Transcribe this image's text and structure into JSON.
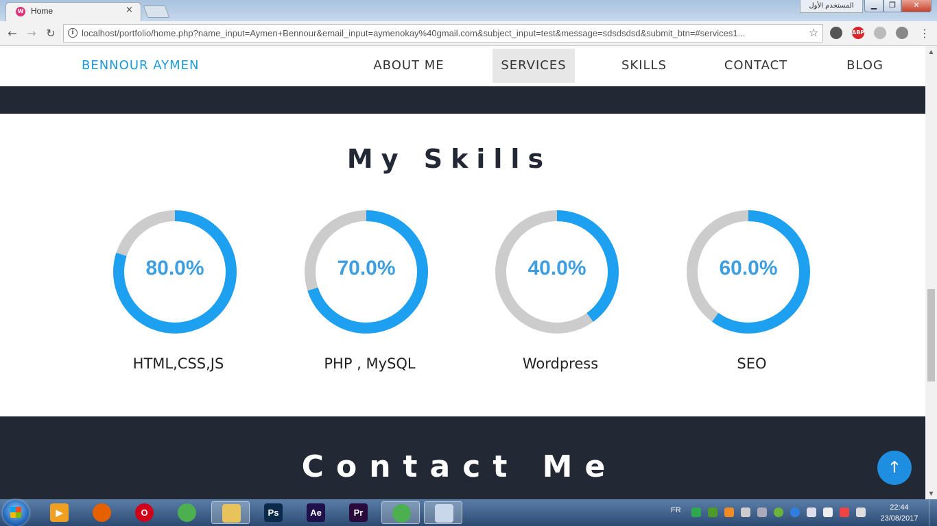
{
  "browser": {
    "tab_title": "Home",
    "tab_close": "×",
    "user_label": "المستخدم الأول",
    "url": "localhost/portfolio/home.php?name_input=Aymen+Bennour&email_input=aymenokay%40gmail.com&subject_input=test&message=sdsdsdsd&submit_btn=#services1...",
    "ext_abp": "ABP",
    "win_min": "▁",
    "win_max": "❐",
    "win_close": "✕",
    "back": "←",
    "forward": "→",
    "reload": "↻",
    "star": "☆",
    "menu": "⋮",
    "info": "i"
  },
  "nav": {
    "brand": "BENNOUR AYMEN",
    "items": [
      "ABOUT ME",
      "SERVICES",
      "SKILLS",
      "CONTACT",
      "BLOG"
    ],
    "active": "SERVICES"
  },
  "skills": {
    "heading": "My Skills",
    "track_color": "#cccccc",
    "fill_color": "#1ea0f0",
    "items": [
      {
        "label": "HTML,CSS,JS",
        "percent_text": "80.0%",
        "value": 80
      },
      {
        "label": "PHP , MySQL",
        "percent_text": "70.0%",
        "value": 70
      },
      {
        "label": "Wordpress",
        "percent_text": "40.0%",
        "value": 40
      },
      {
        "label": "SEO",
        "percent_text": "60.0%",
        "value": 60
      }
    ]
  },
  "contact": {
    "heading": "Contact Me"
  },
  "back_to_top": "🡑",
  "taskbar": {
    "apps": [
      {
        "name": "media-player",
        "glyph": "▶",
        "color": "#f0a020"
      },
      {
        "name": "firefox",
        "glyph": "",
        "color": "#e66000"
      },
      {
        "name": "opera",
        "glyph": "O",
        "color": "#d00018"
      },
      {
        "name": "chrome",
        "glyph": "",
        "color": "#4caf50"
      },
      {
        "name": "explorer",
        "glyph": "",
        "color": "#e8c35c"
      },
      {
        "name": "photoshop",
        "glyph": "Ps",
        "color": "#0b2a4a"
      },
      {
        "name": "after-effects",
        "glyph": "Ae",
        "color": "#1f0f4a"
      },
      {
        "name": "premiere",
        "glyph": "Pr",
        "color": "#2a0a3a"
      },
      {
        "name": "chrome-active",
        "glyph": "",
        "color": "#4caf50"
      },
      {
        "name": "paint",
        "glyph": "",
        "color": "#c9d7ea"
      }
    ],
    "lang": "FR",
    "time": "22:44",
    "date": "23/08/2017"
  }
}
